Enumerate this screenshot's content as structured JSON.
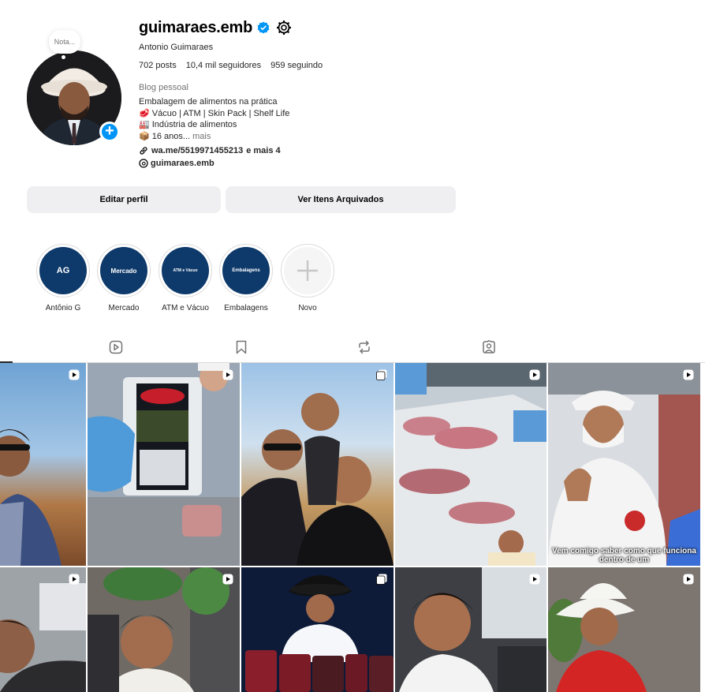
{
  "profile": {
    "note_placeholder": "Nota...",
    "username": "guimaraes.emb",
    "full_name": "Antonio Guimaraes",
    "stats": {
      "posts": "702 posts",
      "followers": "10,4 mil seguidores",
      "following": "959 seguindo"
    },
    "category": "Blog pessoal",
    "bio": {
      "line1": "Embalagem de alimentos na prática",
      "line2": "🥩 Vácuo | ATM | Skin Pack | Shelf Life",
      "line3": "🏭 Indústria de alimentos",
      "line4": "📦 16 anos...",
      "more": "mais"
    },
    "link": {
      "url": "wa.me/5519971455213",
      "extra": "e mais 4"
    },
    "threads": "guimaraes.emb"
  },
  "buttons": {
    "edit": "Editar perfil",
    "archive": "Ver Itens Arquivados"
  },
  "highlights": [
    {
      "cover": "AG",
      "label": "Antônio G"
    },
    {
      "cover": "Mercado",
      "label": "Mercado"
    },
    {
      "cover": "ATM e Vácuo",
      "label": "ATM e Vácuo"
    },
    {
      "cover": "Embalagens",
      "label": "Embalagens"
    },
    {
      "cover": "",
      "label": "Novo"
    }
  ],
  "tabs": [
    "reels-icon",
    "saved-icon",
    "reposts-icon",
    "tagged-icon"
  ],
  "grid": {
    "tile5_caption": "Vem comigo saber como que funciona dentro de um"
  },
  "colors": {
    "accent": "#0095f6",
    "highlight_bg": "#0e3a6b",
    "button_bg": "#efeff2"
  }
}
